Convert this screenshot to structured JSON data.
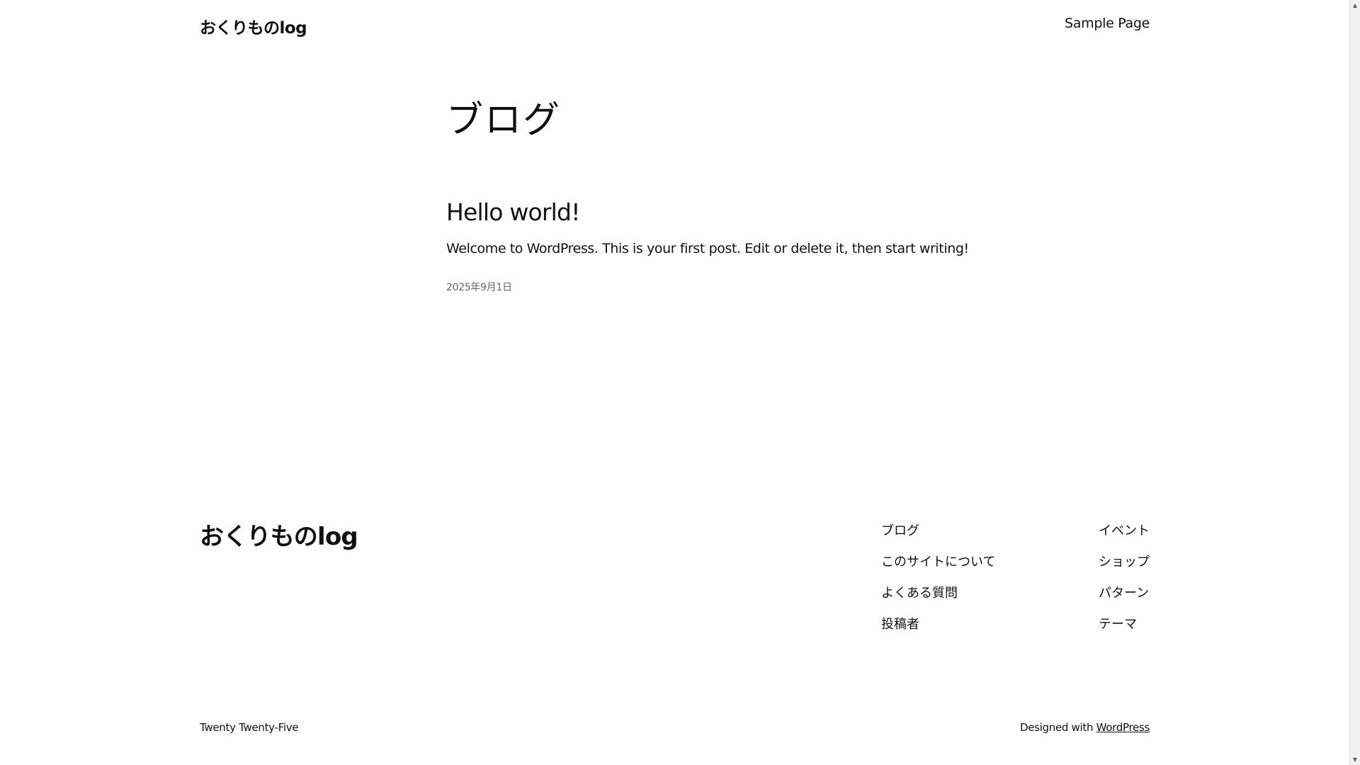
{
  "header": {
    "site_title": "おくりものlog",
    "nav_link": "Sample Page"
  },
  "main": {
    "page_heading": "ブログ",
    "post": {
      "title": "Hello world!",
      "excerpt": "Welcome to WordPress. This is your first post. Edit or delete it, then start writing!",
      "date": "2025年9月1日"
    }
  },
  "footer": {
    "site_title": "おくりものlog",
    "nav_col1": [
      "ブログ",
      "このサイトについて",
      "よくある質問",
      "投稿者"
    ],
    "nav_col2": [
      "イベント",
      "ショップ",
      "パターン",
      "テーマ"
    ],
    "theme_credit": "Twenty Twenty-Five",
    "designed_with_prefix": "Designed with ",
    "designed_with_link": "WordPress"
  },
  "icons": {
    "scroll_up": "scroll-up-arrow-icon",
    "scroll_down": "scroll-down-arrow-icon"
  }
}
